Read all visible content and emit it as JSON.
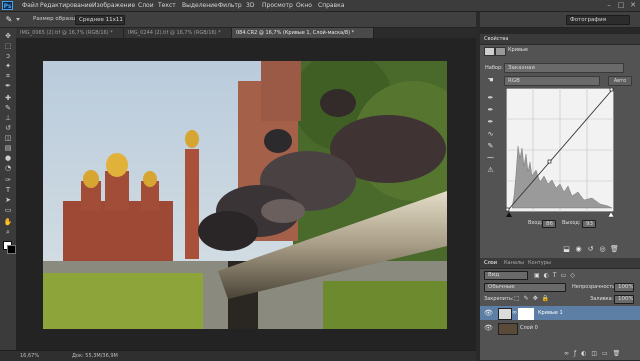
{
  "menu": {
    "logo": "Ps",
    "items": [
      "Файл",
      "Редактирование",
      "Изображение",
      "Слои",
      "Текст",
      "Выделение",
      "Фильтр",
      "3D",
      "Просмотр",
      "Окно",
      "Справка"
    ],
    "window_controls": [
      "–",
      "□",
      "✕"
    ]
  },
  "options_bar": {
    "tool_icon": "eyedropper-icon",
    "sample_size_label": "Размер образца:",
    "sample_size_value": "Среднее 11x11",
    "workspace": "Фотография"
  },
  "tabs": [
    {
      "label": "IMG_0065 (2).tif @ 16,7% (RGB/16) *",
      "active": false
    },
    {
      "label": "IMG_0244 (2).tif @ 16,7% (RGB/16) *",
      "active": false
    },
    {
      "label": "084.CR2 @ 16,7% (Кривые 1, Слой-маска/8) *",
      "active": true
    }
  ],
  "status": {
    "zoom": "16,67%",
    "doc": "Док: 55,3M/36,9M"
  },
  "properties": {
    "panel_title": "Свойства",
    "adjustment_title": "Кривые",
    "preset_label": "Набор:",
    "preset_value": "Заказная",
    "channel_value": "RGB",
    "auto_button": "Авто",
    "input_label": "Вход:",
    "input_value": "86",
    "output_label": "Выход:",
    "output_value": "93"
  },
  "layers_panel": {
    "tabs": [
      "Слои",
      "Каналы",
      "Контуры"
    ],
    "kind_value": "Вид",
    "blend_mode": "Обычные",
    "opacity_label": "Непрозрачность:",
    "opacity_value": "100%",
    "lock_label": "Закрепить:",
    "fill_label": "Заливка:",
    "fill_value": "100%",
    "layers": [
      {
        "name": "Кривые 1",
        "selected": true
      },
      {
        "name": "Слой 0",
        "selected": false
      }
    ]
  },
  "colors": {
    "accent": "#4aa3ea",
    "panel": "#535353",
    "selected_layer": "#5d7fa6"
  }
}
